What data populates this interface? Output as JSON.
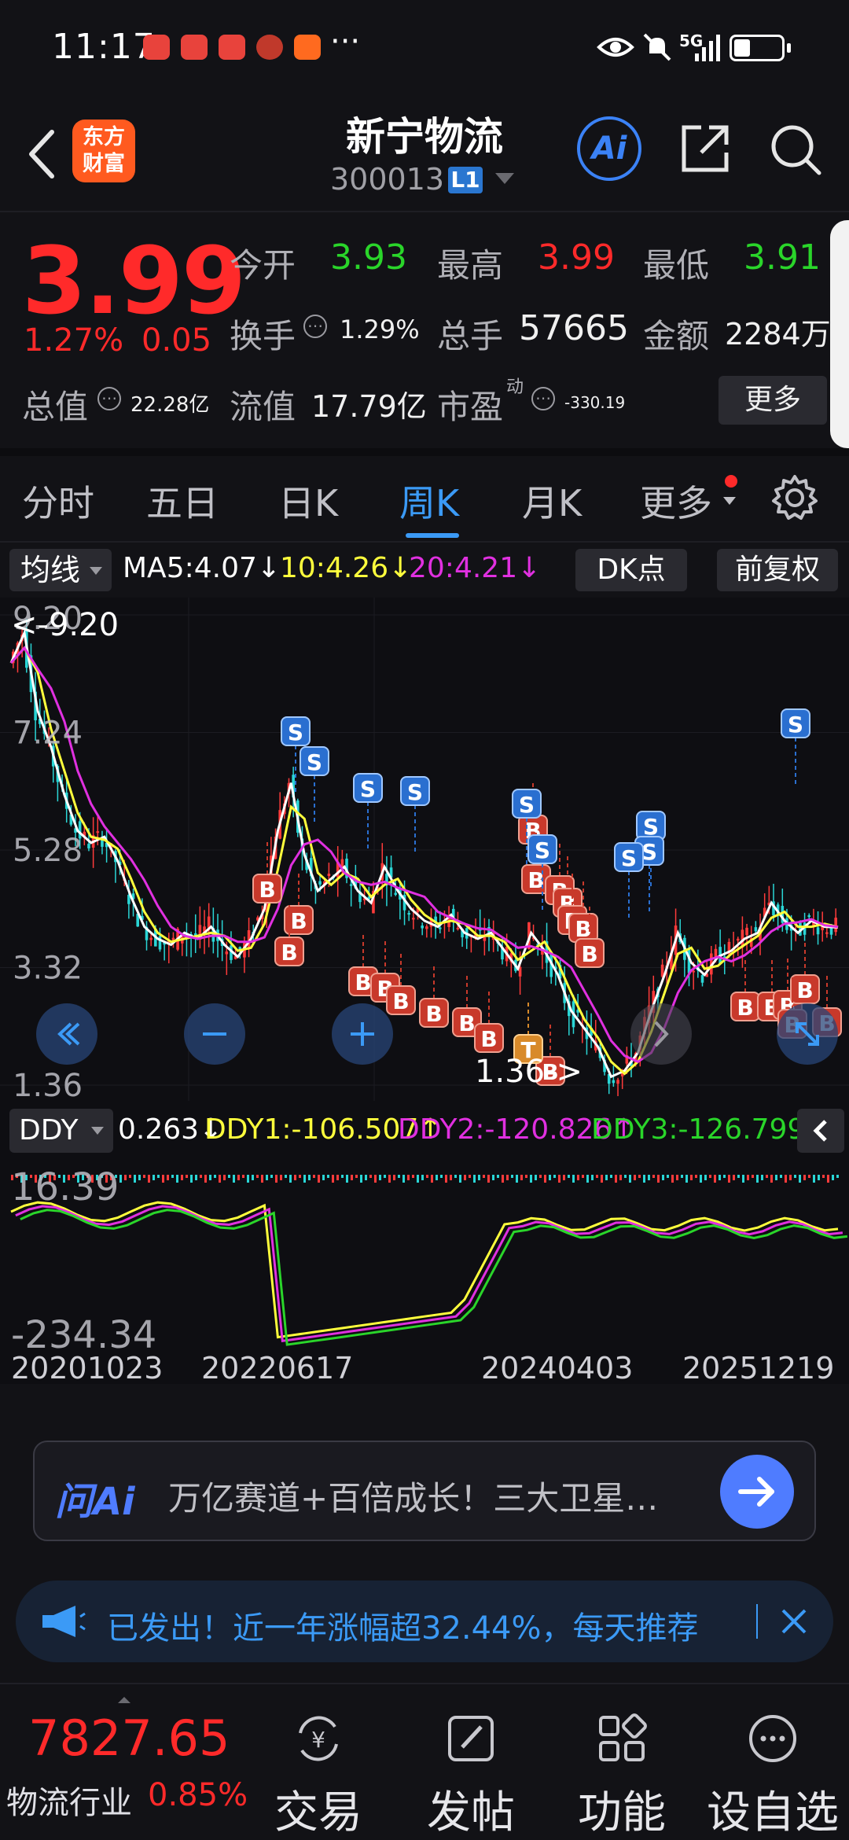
{
  "status_bar": {
    "time": "11:17",
    "dots": "···",
    "network": "5G"
  },
  "header": {
    "brand": "东方\n财富",
    "brand_line1": "东方",
    "brand_line2": "财富",
    "stock_name": "新宁物流",
    "stock_code": "300013",
    "level": "L1",
    "ai_label": "Ai"
  },
  "quote": {
    "price": "3.99",
    "change_pct": "1.27%",
    "change_abs": "0.05",
    "open_label": "今开",
    "open": "3.93",
    "high_label": "最高",
    "high": "3.99",
    "low_label": "最低",
    "low": "3.91",
    "turnover_label": "换手",
    "turnover": "1.29%",
    "volume_label": "总手",
    "volume": "57665",
    "amount_label": "金额",
    "amount": "2284万",
    "mktcap_label": "总值",
    "mktcap": "22.28亿",
    "float_label": "流值",
    "float": "17.79亿",
    "pe_label": "市盈",
    "pe_sup": "动",
    "pe": "-330.19",
    "more": "更多"
  },
  "tabs": [
    {
      "label": "分时"
    },
    {
      "label": "五日"
    },
    {
      "label": "日K"
    },
    {
      "label": "周K"
    },
    {
      "label": "月K"
    },
    {
      "label": "更多"
    }
  ],
  "indicators": {
    "ma_select": "均线",
    "ma5": "MA5:4.07↓",
    "ma10": "10:4.26↓",
    "ma20": "20:4.21↓",
    "dk": "DK点",
    "adjust": "前复权"
  },
  "chart_data": [
    {
      "type": "candlestick",
      "title": "",
      "y_ticks": [
        "9.20",
        "7.24",
        "5.28",
        "3.32",
        "1.36"
      ],
      "ylim": [
        1.36,
        9.2
      ],
      "annotations": [
        "<-9.20",
        "1.36->"
      ],
      "x_ticks": [
        "20201023",
        "20220617",
        "20240403",
        "20251219"
      ],
      "ma_series": [
        {
          "name": "MA5",
          "color": "#ffffff"
        },
        {
          "name": "MA10",
          "color": "#ffff3c"
        },
        {
          "name": "MA20",
          "color": "#e030e0"
        }
      ],
      "close_trace": [
        8.4,
        8.9,
        7.6,
        7.0,
        6.2,
        5.6,
        5.4,
        5.5,
        5.1,
        4.5,
        4.0,
        3.8,
        3.7,
        3.9,
        3.8,
        4.0,
        3.7,
        3.5,
        3.8,
        4.3,
        5.6,
        6.4,
        5.2,
        4.6,
        4.8,
        5.0,
        4.6,
        4.4,
        5.0,
        4.6,
        4.3,
        4.1,
        4.0,
        4.2,
        3.9,
        3.8,
        3.9,
        3.6,
        3.3,
        3.9,
        3.6,
        3.2,
        2.6,
        2.3,
        2.0,
        1.5,
        1.6,
        1.9,
        2.6,
        3.2,
        3.9,
        3.4,
        3.2,
        3.5,
        3.6,
        3.8,
        3.9,
        4.4,
        4.1,
        3.9,
        4.1,
        4.0,
        3.99
      ],
      "signals": {
        "buy_label": "B",
        "sell_label": "S",
        "t_label": "T"
      }
    },
    {
      "type": "line",
      "title": "DDY",
      "y_ticks": [
        "16.39",
        "-234.34"
      ],
      "ylim": [
        -234.34,
        16.39
      ],
      "series": [
        {
          "name": "DDY",
          "value": "0.263↓",
          "color": "#ffffff"
        },
        {
          "name": "DDY1",
          "value": "DDY1:-106.507↑",
          "color": "#ffff3c"
        },
        {
          "name": "DDY2",
          "value": "DDY2:-120.826↑",
          "color": "#e030e0"
        },
        {
          "name": "DDY3",
          "value": "DDY3:-126.799↑",
          "color": "#2ad52a"
        }
      ]
    }
  ],
  "ddy_row": {
    "select": "DDY",
    "ddy": "0.263↓",
    "ddy1": "DDY1:-106.507↑",
    "ddy2": "DDY2:-120.826↑",
    "ddy3": "DDY3:-126.799↑"
  },
  "ai_bar": {
    "logo": "问Ai",
    "text": "万亿赛道+百倍成长！三大卫星…"
  },
  "notice": {
    "text": "已发出！近一年涨幅超32.44%，每天推荐"
  },
  "bottom_nav": {
    "index_value": "7827.65",
    "index_name": "物流行业",
    "index_pct": "0.85%",
    "items": [
      {
        "label": "交易"
      },
      {
        "label": "发帖"
      },
      {
        "label": "功能"
      },
      {
        "label": "设自选"
      }
    ]
  },
  "colors": {
    "up": "#ff2a2a",
    "down": "#2ad52a",
    "accent": "#3b9af6",
    "bg": "#121216"
  }
}
